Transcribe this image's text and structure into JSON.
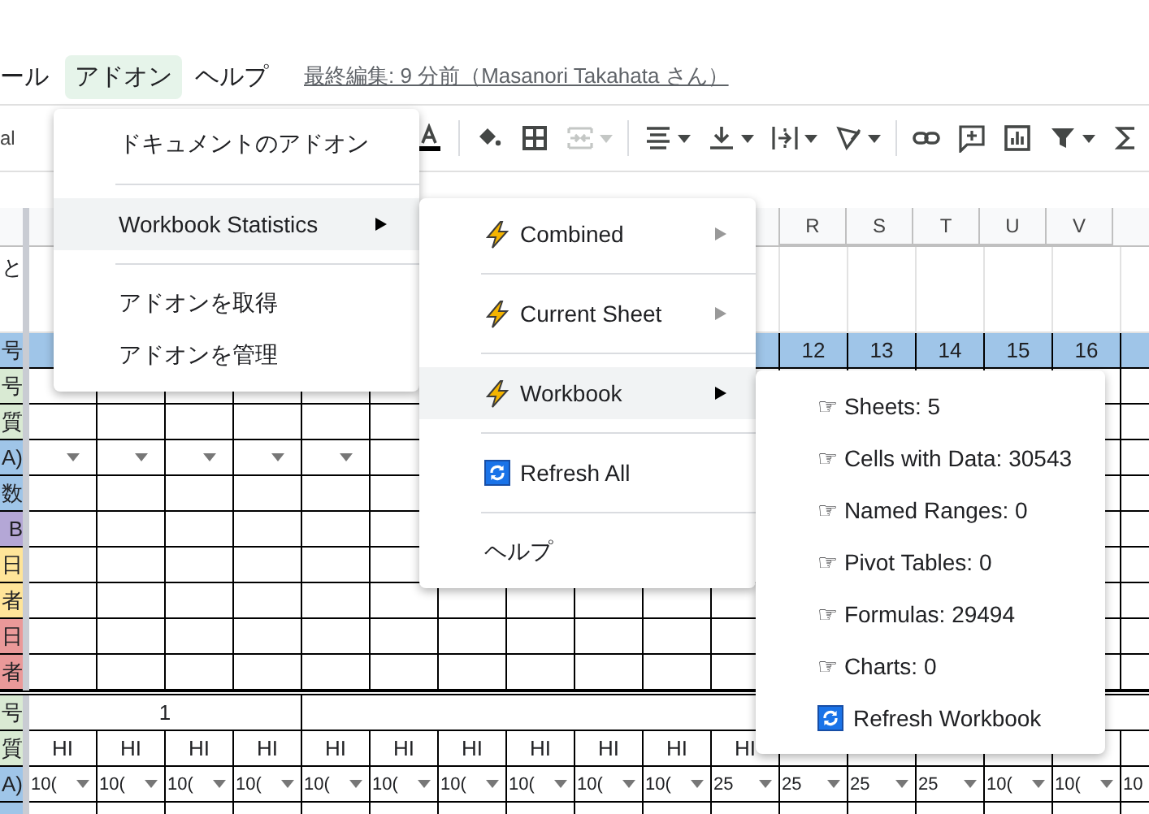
{
  "menu_bar": [
    {
      "label": "ール",
      "selected": false
    },
    {
      "label": "アドオン",
      "selected": true
    },
    {
      "label": "ヘルプ",
      "selected": false
    }
  ],
  "last_edit": "最終編集: 9 分前（Masanori Takahata さん）",
  "toolbar": {
    "font": "al",
    "buttons": [
      {
        "kind": "text-color",
        "disabled": false,
        "caret": false
      },
      {
        "kind": "sep"
      },
      {
        "kind": "fill",
        "disabled": false,
        "caret": false
      },
      {
        "kind": "borders",
        "disabled": false,
        "caret": false
      },
      {
        "kind": "merge",
        "disabled": true,
        "caret": true
      },
      {
        "kind": "sep"
      },
      {
        "kind": "halign",
        "disabled": false,
        "caret": true
      },
      {
        "kind": "valign",
        "disabled": false,
        "caret": true
      },
      {
        "kind": "wrap",
        "disabled": false,
        "caret": true
      },
      {
        "kind": "rotate",
        "disabled": false,
        "caret": true
      },
      {
        "kind": "sep"
      },
      {
        "kind": "link",
        "disabled": false,
        "caret": false
      },
      {
        "kind": "comment",
        "disabled": false,
        "caret": false
      },
      {
        "kind": "chart",
        "disabled": false,
        "caret": false
      },
      {
        "kind": "filter",
        "disabled": false,
        "caret": true
      },
      {
        "kind": "sigma",
        "disabled": false,
        "caret": false
      }
    ]
  },
  "sheet": {
    "rows": [
      {
        "kind": "header",
        "right": [
          {
            "text": "R"
          },
          {
            "text": "S"
          },
          {
            "text": "T"
          },
          {
            "text": "U"
          },
          {
            "text": "V"
          }
        ]
      },
      {
        "kind": "tall",
        "label": "と"
      },
      {
        "kind": "band",
        "label": "号",
        "color": "#9fc5e8",
        "right": [
          {
            "text": "12"
          },
          {
            "text": "13"
          },
          {
            "text": "14"
          },
          {
            "text": "15"
          },
          {
            "text": "16"
          }
        ]
      },
      {
        "kind": "data",
        "label": "号",
        "color": "#d9ead3"
      },
      {
        "kind": "data",
        "label": "質",
        "color": "#d9ead3"
      },
      {
        "kind": "data",
        "label": "A)",
        "color": "#9fc5e8",
        "left": [
          {
            "dropdown": true
          },
          {
            "dropdown": true
          },
          {
            "dropdown": true
          },
          {
            "dropdown": true
          },
          {
            "dropdown": true
          }
        ]
      },
      {
        "kind": "data",
        "label": "数",
        "color": "#9fc5e8"
      },
      {
        "kind": "data",
        "label": "B",
        "color": "#b4a7d6"
      },
      {
        "kind": "data",
        "label": "日",
        "color": "#ffe599"
      },
      {
        "kind": "data",
        "label": "者",
        "color": "#ffe599"
      },
      {
        "kind": "data",
        "label": "日",
        "color": "#ea9999"
      },
      {
        "kind": "data",
        "label": "者",
        "color": "#ea9999"
      },
      {
        "kind": "merged",
        "label": "号",
        "color": "#d9ead3",
        "left": [
          {
            "text": "1"
          }
        ]
      },
      {
        "kind": "data",
        "label": "質",
        "color": "#d9ead3",
        "left": [
          {
            "text": "HI"
          },
          {
            "text": "HI"
          },
          {
            "text": "HI"
          },
          {
            "text": "HI"
          },
          {
            "text": "HI"
          },
          {
            "text": "HI"
          },
          {
            "text": "HI"
          },
          {
            "text": "HI"
          },
          {
            "text": "HI"
          },
          {
            "text": "HI"
          },
          {
            "text": "HI"
          }
        ]
      },
      {
        "kind": "data",
        "label": "A)",
        "color": "#9fc5e8",
        "left": [
          {
            "text": "10(",
            "dropdown": true
          },
          {
            "text": "10(",
            "dropdown": true
          },
          {
            "text": "10(",
            "dropdown": true
          },
          {
            "text": "10(",
            "dropdown": true
          },
          {
            "text": "10(",
            "dropdown": true
          },
          {
            "text": "10(",
            "dropdown": true
          },
          {
            "text": "10(",
            "dropdown": true
          },
          {
            "text": "10(",
            "dropdown": true
          },
          {
            "text": "10(",
            "dropdown": true
          },
          {
            "text": "10(",
            "dropdown": true
          },
          {
            "text": "25",
            "dropdown": true
          }
        ],
        "right": [
          {
            "text": "25",
            "dropdown": true
          },
          {
            "text": "25",
            "dropdown": true
          },
          {
            "text": "25",
            "dropdown": true
          },
          {
            "text": "10(",
            "dropdown": true
          },
          {
            "text": "10(",
            "dropdown": true
          },
          {
            "text": "10",
            "dropdown": true
          }
        ]
      },
      {
        "kind": "partial",
        "color": "#9fc5e8"
      }
    ]
  },
  "addon_menu": [
    {
      "kind": "plain",
      "label": "ドキュメントのアドオン",
      "selected": false,
      "submenu": false
    },
    {
      "kind": "sep"
    },
    {
      "kind": "plain",
      "label": "Workbook Statistics",
      "selected": true,
      "submenu": true
    },
    {
      "kind": "sep"
    },
    {
      "kind": "plain",
      "label": "アドオンを取得",
      "selected": false,
      "submenu": false
    },
    {
      "kind": "plain",
      "label": "アドオンを管理",
      "selected": false,
      "submenu": false
    }
  ],
  "stats_menu": [
    {
      "kind": "bolt",
      "label": "Combined",
      "selected": false,
      "submenu": true
    },
    {
      "kind": "sep"
    },
    {
      "kind": "bolt",
      "label": "Current Sheet",
      "selected": false,
      "submenu": true
    },
    {
      "kind": "sep"
    },
    {
      "kind": "bolt",
      "label": "Workbook",
      "selected": true,
      "submenu": true
    },
    {
      "kind": "sep"
    },
    {
      "kind": "refresh",
      "label": "Refresh All",
      "selected": false,
      "submenu": false
    },
    {
      "kind": "sep"
    },
    {
      "kind": "plain",
      "label": "ヘルプ",
      "selected": false,
      "submenu": false
    }
  ],
  "workbook_menu": [
    {
      "kind": "plain",
      "label": "☞ Sheets: 5"
    },
    {
      "kind": "plain",
      "label": "☞ Cells with Data: 30543"
    },
    {
      "kind": "plain",
      "label": "☞ Named Ranges: 0"
    },
    {
      "kind": "plain",
      "label": "☞ Pivot Tables: 0"
    },
    {
      "kind": "plain",
      "label": "☞ Formulas: 29494"
    },
    {
      "kind": "plain",
      "label": "☞ Charts: 0"
    },
    {
      "kind": "refresh",
      "label": "Refresh Workbook"
    }
  ]
}
